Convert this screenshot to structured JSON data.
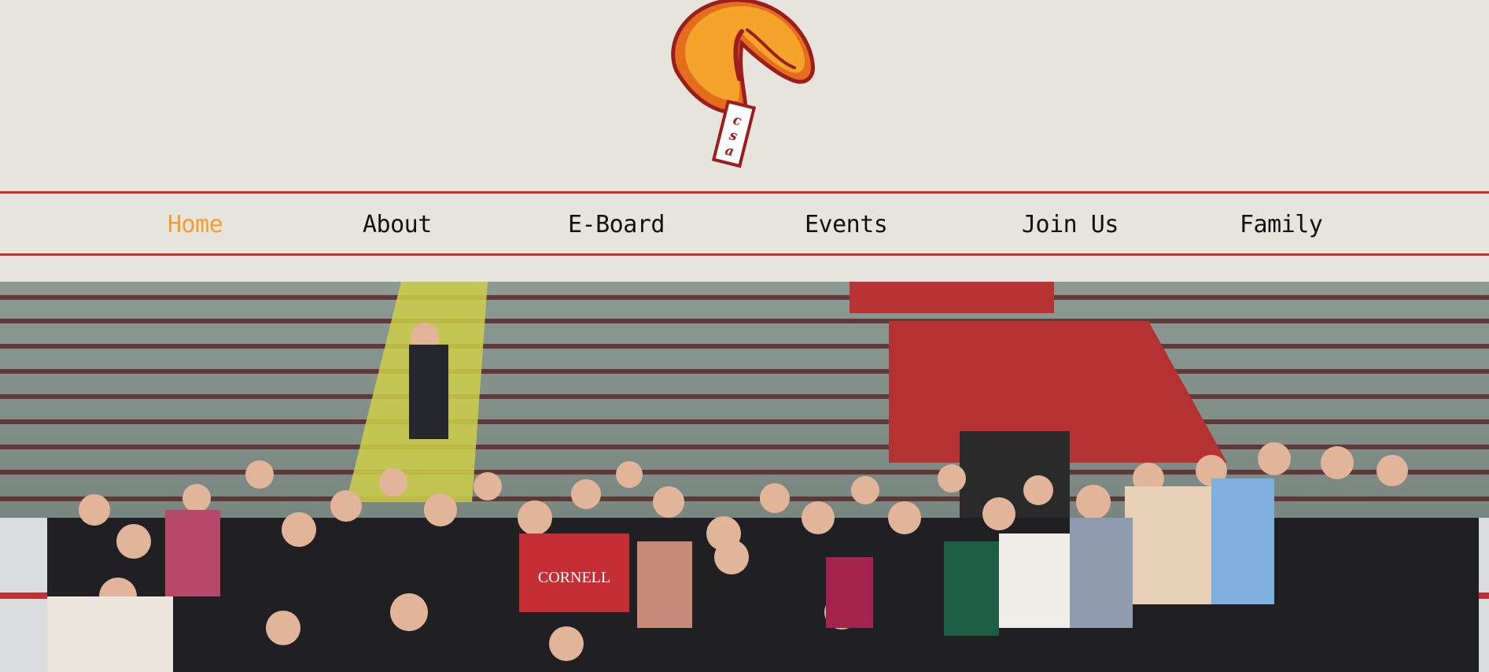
{
  "logo": {
    "alt": "CSA fortune cookie logo",
    "tag_text": "csa",
    "colors": {
      "cookie_fill": "#f4a42a",
      "cookie_shadow": "#e46d1e",
      "outline": "#9b1d1d",
      "tag_fill": "#ffffff"
    }
  },
  "nav": {
    "items": [
      {
        "label": "Home",
        "active": true
      },
      {
        "label": "About",
        "active": false
      },
      {
        "label": "E-Board",
        "active": false
      },
      {
        "label": "Events",
        "active": false
      },
      {
        "label": "Join Us",
        "active": false
      },
      {
        "label": "Family",
        "active": false
      }
    ],
    "active_color": "#f0a030",
    "text_color": "#111111",
    "border_color": "#c9302c"
  },
  "hero": {
    "alt": "Group photo of club members at an ice rink",
    "sweater_text": "CORNELL"
  },
  "page": {
    "background": "#e7e3dd"
  }
}
